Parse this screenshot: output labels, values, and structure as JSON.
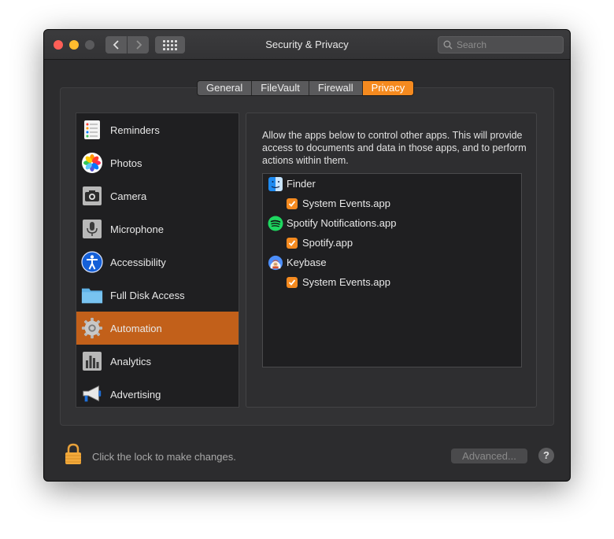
{
  "window": {
    "title": "Security & Privacy"
  },
  "search": {
    "placeholder": "Search"
  },
  "tabs": [
    {
      "label": "General"
    },
    {
      "label": "FileVault"
    },
    {
      "label": "Firewall"
    },
    {
      "label": "Privacy",
      "active": true
    }
  ],
  "sidebar": {
    "items": [
      {
        "label": "Reminders",
        "icon": "reminders-icon"
      },
      {
        "label": "Photos",
        "icon": "photos-icon"
      },
      {
        "label": "Camera",
        "icon": "camera-icon"
      },
      {
        "label": "Microphone",
        "icon": "microphone-icon"
      },
      {
        "label": "Accessibility",
        "icon": "accessibility-icon"
      },
      {
        "label": "Full Disk Access",
        "icon": "folder-icon"
      },
      {
        "label": "Automation",
        "icon": "gear-icon",
        "selected": true
      },
      {
        "label": "Analytics",
        "icon": "analytics-icon"
      },
      {
        "label": "Advertising",
        "icon": "megaphone-icon"
      }
    ]
  },
  "main": {
    "description": "Allow the apps below to control other apps. This will provide access to documents and data in those apps, and to perform actions within them.",
    "apps": [
      {
        "name": "Finder",
        "icon": "finder-icon",
        "targets": [
          {
            "name": "System Events.app",
            "checked": true
          }
        ]
      },
      {
        "name": "Spotify Notifications.app",
        "icon": "spotify-icon",
        "targets": [
          {
            "name": "Spotify.app",
            "checked": true
          }
        ]
      },
      {
        "name": "Keybase",
        "icon": "keybase-icon",
        "targets": [
          {
            "name": "System Events.app",
            "checked": true
          }
        ]
      }
    ]
  },
  "footer": {
    "lock_text": "Click the lock to make changes.",
    "advanced_label": "Advanced...",
    "help_label": "?"
  },
  "colors": {
    "accent": "#f58a1f",
    "selection": "#c2601a"
  }
}
